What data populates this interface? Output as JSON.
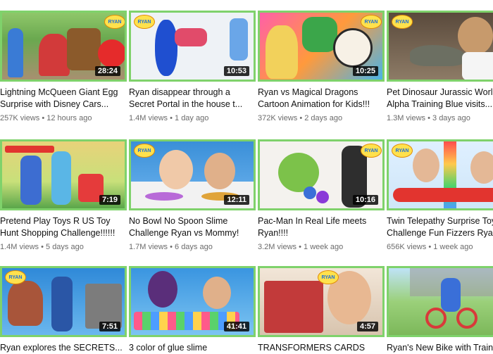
{
  "brand_text": "RYAN",
  "videos": [
    {
      "title_line1": "Lightning McQueen Giant Egg",
      "title_line2": "Surprise with Disney Cars...",
      "views": "257K views",
      "age": "12 hours ago",
      "duration": "28:24"
    },
    {
      "title_line1": "Ryan disappear through a",
      "title_line2": "Secret Portal in the house t...",
      "views": "1.4M views",
      "age": "1 day ago",
      "duration": "10:53"
    },
    {
      "title_line1": "Ryan vs Magical Dragons",
      "title_line2": "Cartoon Animation for Kids!!!",
      "views": "372K views",
      "age": "2 days ago",
      "duration": "10:25"
    },
    {
      "title_line1": "Pet Dinosaur Jurassic World",
      "title_line2": "Alpha Training Blue visits...",
      "views": "1.3M views",
      "age": "3 days ago",
      "duration": ""
    },
    {
      "title_line1": "Pretend Play Toys R US Toy",
      "title_line2": "Hunt Shopping Challenge!!!!!!",
      "views": "1.4M views",
      "age": "5 days ago",
      "duration": "7:19"
    },
    {
      "title_line1": "No Bowl No Spoon Slime",
      "title_line2": "Challenge Ryan vs Mommy!",
      "views": "1.7M views",
      "age": "6 days ago",
      "duration": "12:11"
    },
    {
      "title_line1": "Pac-Man In Real Life meets",
      "title_line2": "Ryan!!!!",
      "views": "3.2M views",
      "age": "1 week ago",
      "duration": "10:16"
    },
    {
      "title_line1": "Twin Telepathy Surprise Toy",
      "title_line2": "Challenge Fun Fizzers Ryan...",
      "views": "656K views",
      "age": "1 week ago",
      "duration": ""
    },
    {
      "title_line1": "Ryan explores the SECRETS...",
      "title_line2": "",
      "views": "",
      "age": "",
      "duration": "7:51"
    },
    {
      "title_line1": "3 color of glue slime",
      "title_line2": "",
      "views": "",
      "age": "",
      "duration": "41:41"
    },
    {
      "title_line1": "TRANSFORMERS CARDS",
      "title_line2": "",
      "views": "",
      "age": "",
      "duration": "4:57"
    },
    {
      "title_line1": "Ryan's New Bike with Training",
      "title_line2": "",
      "views": "",
      "age": "",
      "duration": ""
    }
  ],
  "meta_separator": "•",
  "icons": [
    "ryan-logo-icon",
    "play-thumbnail"
  ],
  "colors": {
    "thumb_border": "#7fd26b",
    "title": "#111111",
    "meta": "#6b6b6b",
    "duration_bg": "#000000"
  }
}
